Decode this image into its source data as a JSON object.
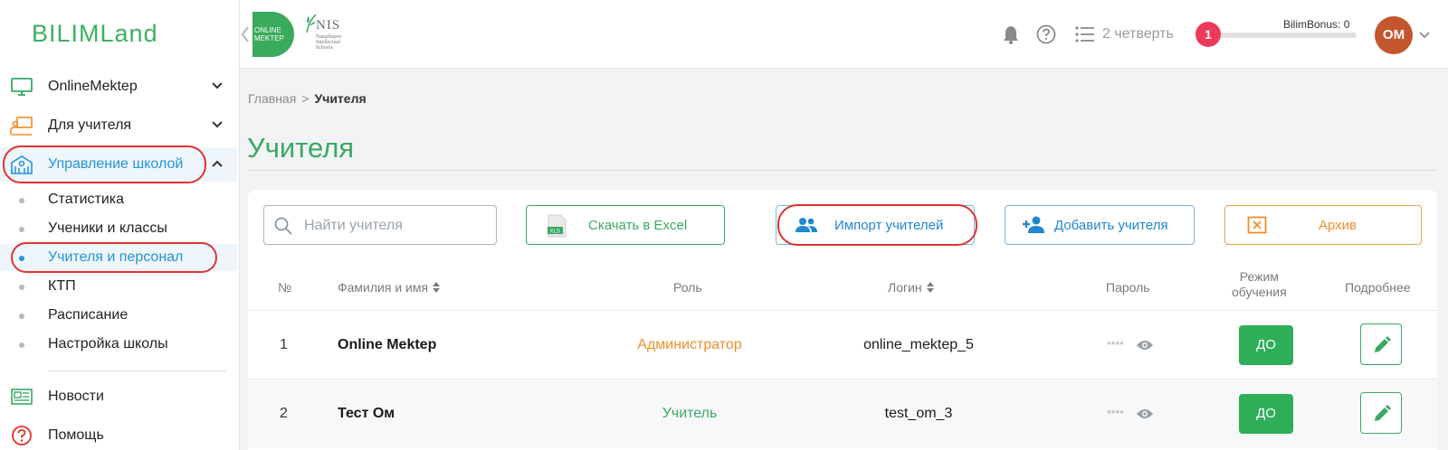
{
  "brand": {
    "logo_text": "BILIMLand",
    "accent": "#3aa864",
    "link_blue": "#1f96d8"
  },
  "sidebar": {
    "sections": [
      {
        "label": "OnlineMektep",
        "icon": "monitor-icon"
      },
      {
        "label": "Для учителя",
        "icon": "teacher-board-icon"
      },
      {
        "label": "Управление школой",
        "icon": "school-building-icon"
      }
    ],
    "subitems": [
      {
        "label": "Статистика"
      },
      {
        "label": "Ученики и классы"
      },
      {
        "label": "Учителя и персонал"
      },
      {
        "label": "КТП"
      },
      {
        "label": "Расписание"
      },
      {
        "label": "Настройка школы"
      }
    ],
    "bottom": [
      {
        "label": "Новости",
        "icon": "news-icon"
      },
      {
        "label": "Помощь",
        "icon": "help-icon"
      }
    ]
  },
  "header": {
    "om_logo_text": "ONLINE MEKTEP",
    "nis_logo": {
      "title": "NIS",
      "subtitle": "Nazarbayev Intellectual Schools"
    },
    "quarter": "2 четверть",
    "bonus_count": "1",
    "bonus_label": "BilimBonus: 0",
    "bonus_progress": 0,
    "avatar_initials": "OM"
  },
  "breadcrumb": {
    "home": "Главная",
    "separator": ">",
    "current": "Учителя"
  },
  "page_title": "Учителя",
  "toolbar": {
    "search_placeholder": "Найти учителя",
    "excel_label": "Скачать в Excel",
    "excel_icon_text": "XLS",
    "import_label": "Импорт учителей",
    "add_label": "Добавить учителя",
    "archive_label": "Архив"
  },
  "table": {
    "headers": {
      "num": "№",
      "name": "Фамилия и имя",
      "role": "Роль",
      "login": "Логин",
      "password": "Пароль",
      "mode_line1": "Режим",
      "mode_line2": "обучения",
      "details": "Подробнее"
    },
    "rows": [
      {
        "num": "1",
        "name": "Online Mektep",
        "role": "Администратор",
        "role_color": "#ef8f2b",
        "login": "online_mektep_5",
        "password": "****",
        "mode": "ДО"
      },
      {
        "num": "2",
        "name": "Тест Ом",
        "role": "Учитель",
        "role_color": "#3aa864",
        "login": "test_om_3",
        "password": "****",
        "mode": "ДО"
      }
    ]
  }
}
